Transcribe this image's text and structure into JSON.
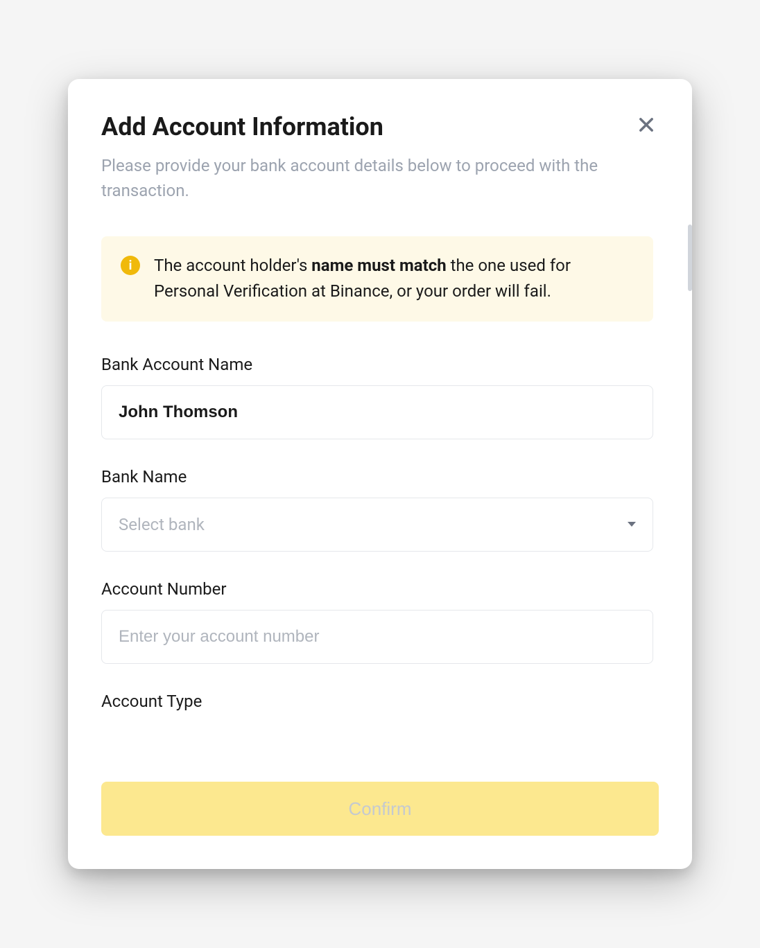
{
  "modal": {
    "title": "Add Account Information",
    "subtitle": "Please provide your bank account details below to proceed with the transaction."
  },
  "alert": {
    "text_before": "The account holder's ",
    "text_bold": "name must match",
    "text_after": " the one used for Personal Verification at Binance, or your order will fail.",
    "icon_char": "i"
  },
  "form": {
    "bank_account_name": {
      "label": "Bank Account Name",
      "value": "John Thomson"
    },
    "bank_name": {
      "label": "Bank Name",
      "placeholder": "Select bank"
    },
    "account_number": {
      "label": "Account Number",
      "placeholder": "Enter your account number",
      "value": ""
    },
    "account_type": {
      "label": "Account Type"
    }
  },
  "actions": {
    "confirm_label": "Confirm"
  }
}
